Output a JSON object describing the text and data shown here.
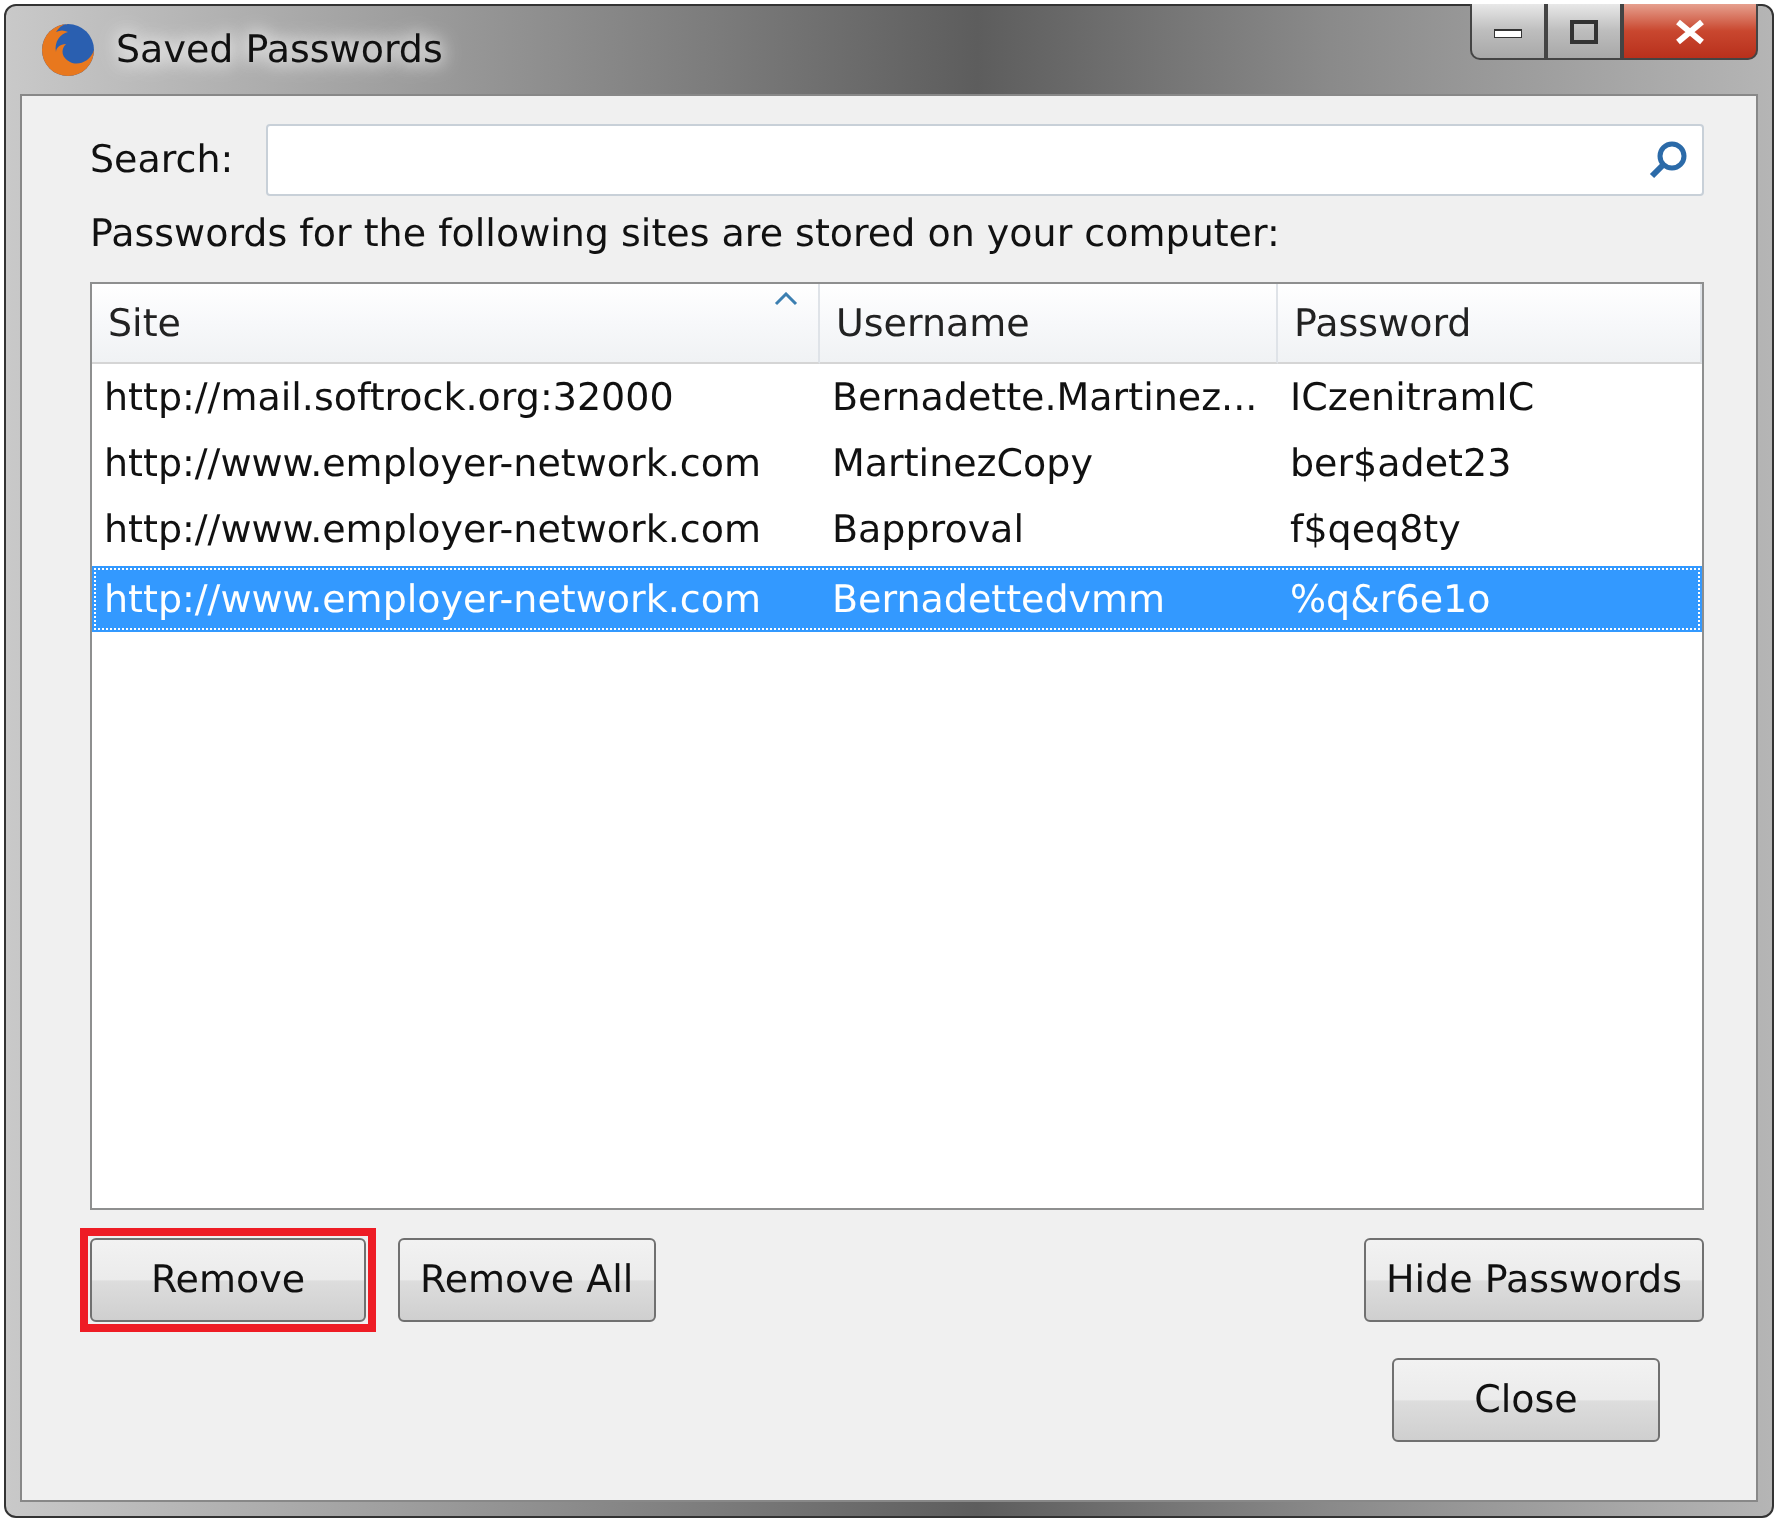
{
  "window": {
    "title": "Saved Passwords"
  },
  "search": {
    "label": "Search:"
  },
  "caption": "Passwords for the following sites are stored on your computer:",
  "table": {
    "columns": [
      {
        "label": "Site",
        "sorted": true
      },
      {
        "label": "Username",
        "sorted": false
      },
      {
        "label": "Password",
        "sorted": false
      }
    ],
    "rows": [
      {
        "cells": [
          "http://mail.softrock.org:32000",
          "Bernadette.Martinez...",
          "ICzenitramIC"
        ],
        "selected": false
      },
      {
        "cells": [
          "http://www.employer-network.com",
          "MartinezCopy",
          "ber$adet23"
        ],
        "selected": false
      },
      {
        "cells": [
          "http://www.employer-network.com",
          "Bapproval",
          "f$qeq8ty"
        ],
        "selected": false
      },
      {
        "cells": [
          "http://www.employer-network.com",
          "Bernadettedvmm",
          "%q&r6e1o"
        ],
        "selected": true
      }
    ]
  },
  "buttons": [
    {
      "label": "Remove",
      "highlighted": true
    },
    {
      "label": "Remove All",
      "highlighted": false
    },
    {
      "label": "Hide Passwords",
      "highlighted": false
    }
  ],
  "close_button": "Close"
}
